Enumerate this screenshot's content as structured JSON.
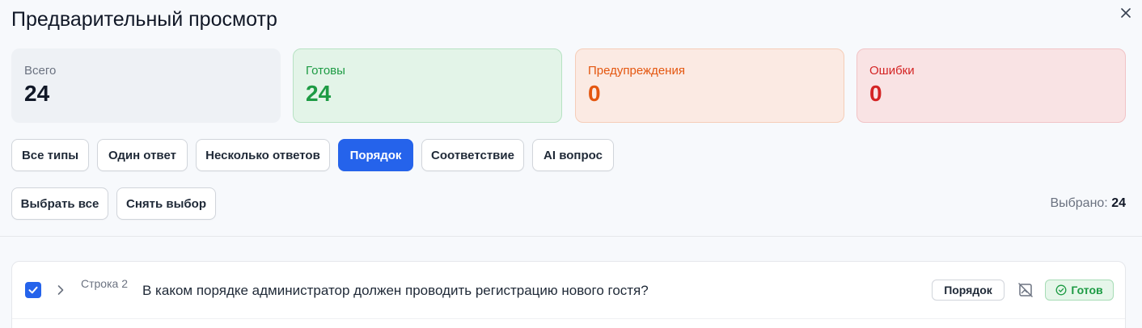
{
  "dialog": {
    "title": "Предварительный просмотр",
    "close_icon": "close-icon"
  },
  "stats": {
    "total": {
      "label": "Всего",
      "value": "24"
    },
    "ready": {
      "label": "Готовы",
      "value": "24"
    },
    "warnings": {
      "label": "Предупреждения",
      "value": "0"
    },
    "errors": {
      "label": "Ошибки",
      "value": "0"
    }
  },
  "filters": {
    "all_types": "Все типы",
    "single": "Один ответ",
    "multiple": "Несколько ответов",
    "order": "Порядок",
    "matching": "Соответствие",
    "ai": "AI вопрос",
    "active": "Порядок"
  },
  "selection": {
    "select_all": "Выбрать все",
    "deselect": "Снять выбор",
    "selected_label": "Выбрано:",
    "selected_count": "24"
  },
  "rows": [
    {
      "row_label": "Строка 2",
      "question": "В каком порядке администратор должен проводить регистрацию нового гостя?",
      "type": "Порядок",
      "status": "Готов",
      "checked": true
    }
  ],
  "colors": {
    "accent": "#2563eb",
    "ready": "#1d9b44",
    "warning": "#e4560f",
    "error": "#d42424"
  }
}
